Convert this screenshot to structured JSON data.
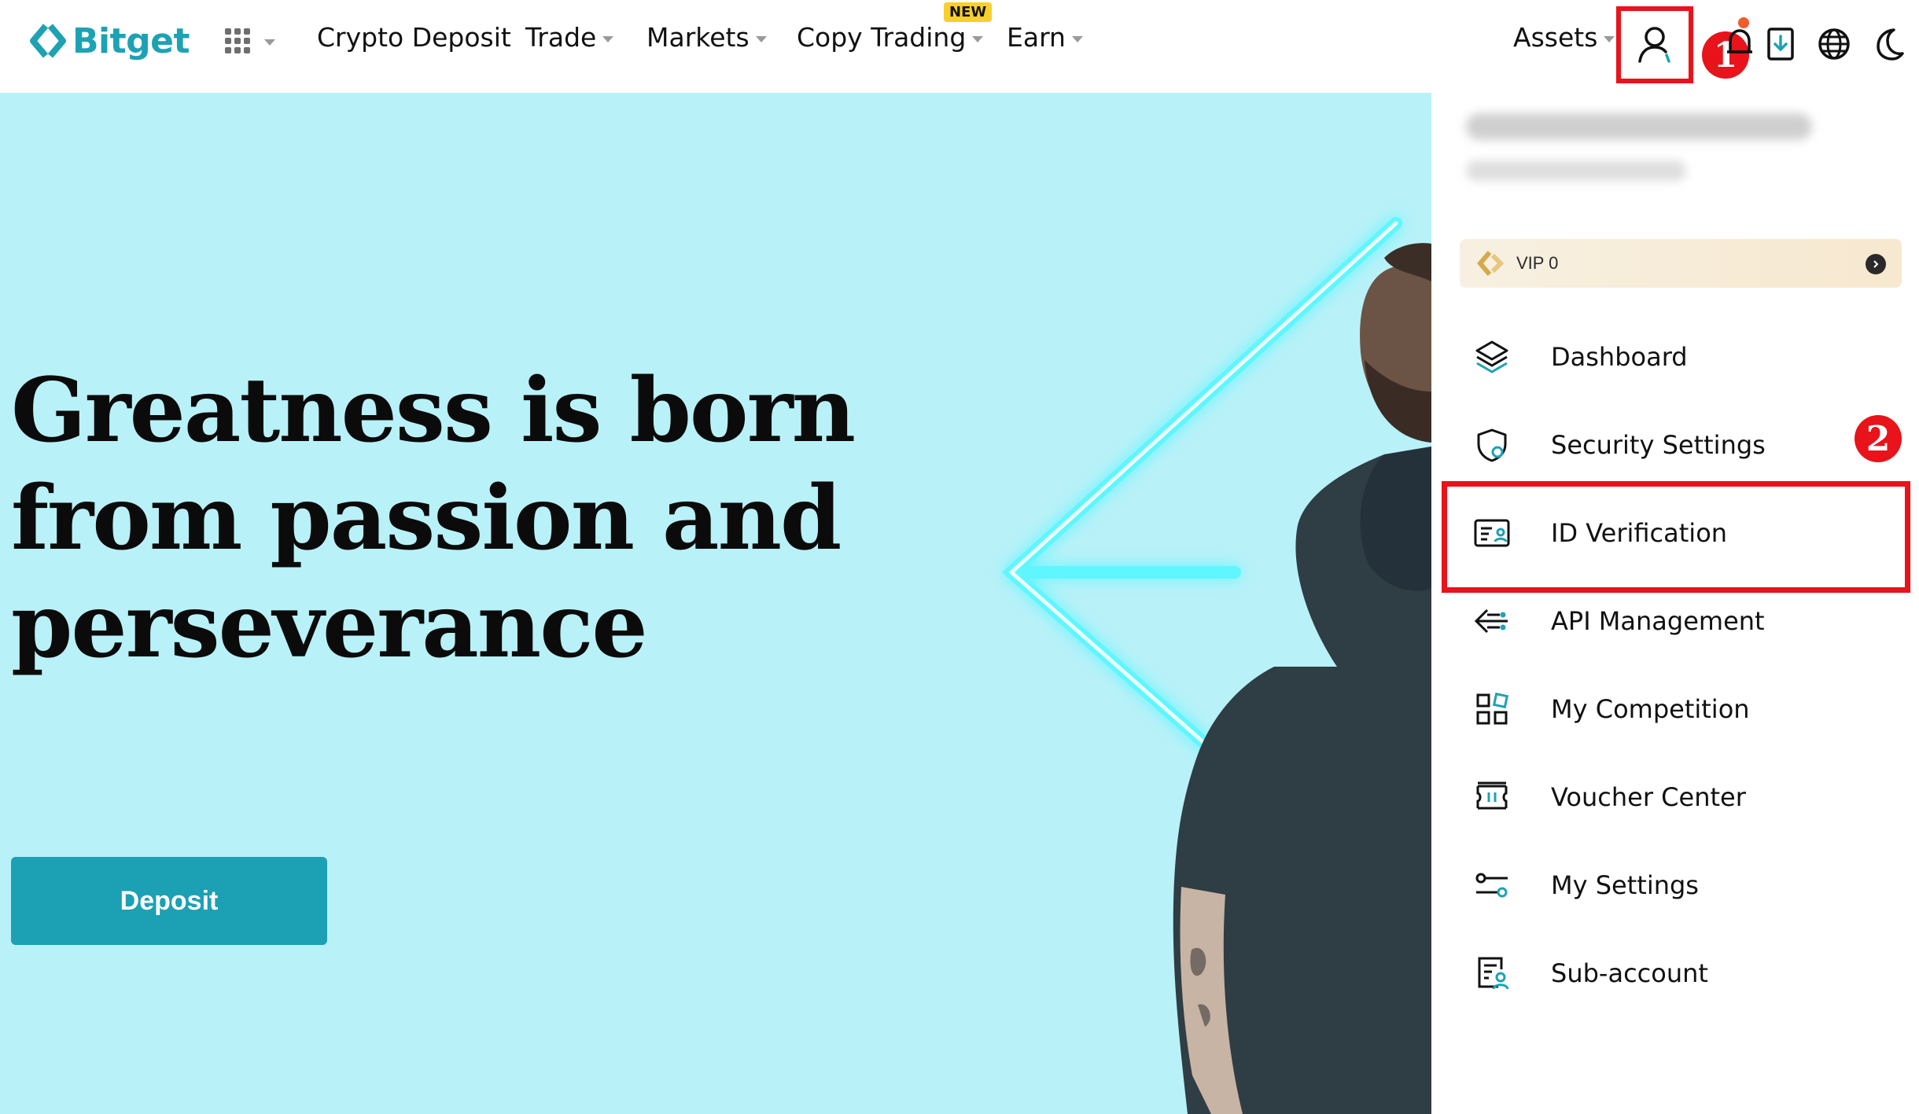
{
  "brand": {
    "name": "Bitget",
    "color": "#1da2b4"
  },
  "nav": {
    "items": [
      {
        "label": "Crypto Deposit",
        "has_caret": false
      },
      {
        "label": "Trade",
        "has_caret": true
      },
      {
        "label": "Markets",
        "has_caret": true
      },
      {
        "label": "Copy Trading",
        "has_caret": true
      },
      {
        "label": "Earn",
        "has_caret": true
      }
    ],
    "new_badge": "NEW",
    "assets_label": "Assets"
  },
  "hero": {
    "headline_lines": [
      "Greatness is born",
      "from passion and",
      "perseverance"
    ],
    "cta_label": "Deposit"
  },
  "annotations": {
    "step1": "1",
    "step2": "2",
    "highlight_color": "#e8131b"
  },
  "profile_menu": {
    "vip_label": "VIP 0",
    "items": [
      {
        "label": "Dashboard",
        "icon": "layers-icon"
      },
      {
        "label": "Security Settings",
        "icon": "shield-icon"
      },
      {
        "label": "ID Verification",
        "icon": "id-card-icon"
      },
      {
        "label": "API Management",
        "icon": "api-icon"
      },
      {
        "label": "My Competition",
        "icon": "grid-icon"
      },
      {
        "label": "Voucher Center",
        "icon": "voucher-icon"
      },
      {
        "label": "My Settings",
        "icon": "sliders-icon"
      },
      {
        "label": "Sub-account",
        "icon": "sub-account-icon"
      }
    ]
  }
}
